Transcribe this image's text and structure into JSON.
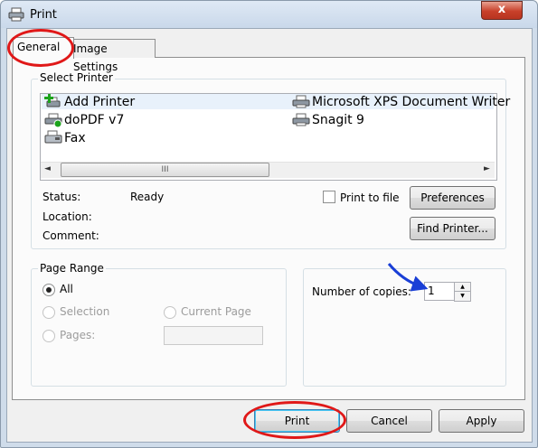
{
  "window": {
    "title": "Print",
    "close_glyph": "x"
  },
  "tabs": [
    {
      "label": "General",
      "selected": true
    },
    {
      "label": "Image Settings",
      "selected": false
    }
  ],
  "select_printer": {
    "group_label": "Select Printer",
    "printers": [
      {
        "name": "Add Printer",
        "icon": "add-printer-icon"
      },
      {
        "name": "Microsoft XPS Document Writer",
        "icon": "printer-icon"
      },
      {
        "name": "doPDF v7",
        "icon": "printer-check-icon"
      },
      {
        "name": "Snagit 9",
        "icon": "printer-icon"
      },
      {
        "name": "Fax",
        "icon": "fax-icon"
      }
    ],
    "status_label": "Status:",
    "status_value": "Ready",
    "location_label": "Location:",
    "comment_label": "Comment:",
    "print_to_file_label": "Print to file",
    "print_to_file_checked": false,
    "preferences_label": "Preferences",
    "find_printer_label": "Find Printer...",
    "scroll_grip": "III"
  },
  "page_range": {
    "group_label": "Page Range",
    "all_label": "All",
    "selection_label": "Selection",
    "current_page_label": "Current Page",
    "pages_label": "Pages:",
    "selected": "All",
    "pages_value": ""
  },
  "copies": {
    "label": "Number of copies:",
    "value": "1"
  },
  "footer": {
    "print_label": "Print",
    "cancel_label": "Cancel",
    "apply_label": "Apply"
  },
  "colors": {
    "highlight_ring": "#e01818",
    "annotation_arrow": "#1a3fd6",
    "title_bar": "#dfe9f5",
    "close_button": "#c8402a"
  }
}
